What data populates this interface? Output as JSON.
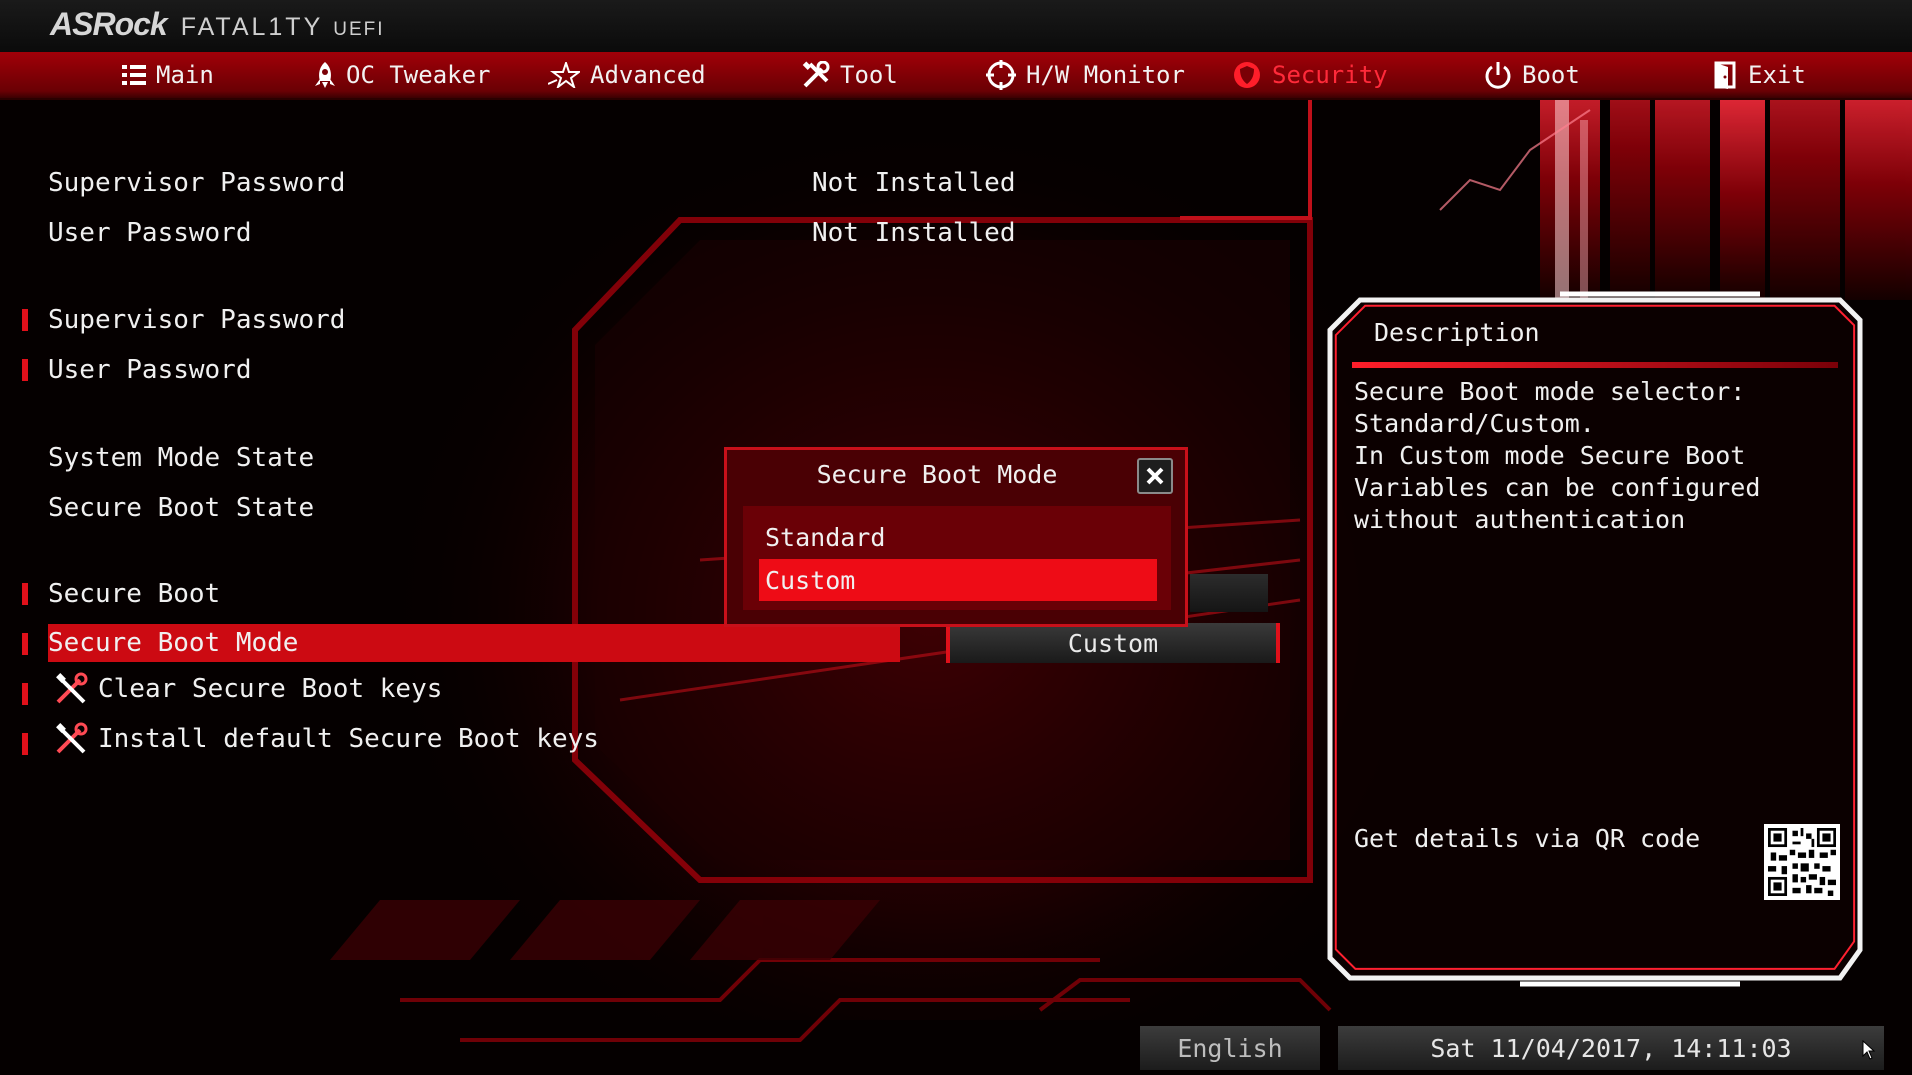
{
  "brand": {
    "name": "ASRock",
    "product": "FATAL1TY",
    "firmware": "UEFI"
  },
  "tabs": [
    {
      "label": "Main",
      "icon": "list-icon",
      "active": false
    },
    {
      "label": "OC Tweaker",
      "icon": "rocket-icon",
      "active": false
    },
    {
      "label": "Advanced",
      "icon": "star-icon",
      "active": false
    },
    {
      "label": "Tool",
      "icon": "wrench-icon",
      "active": false
    },
    {
      "label": "H/W Monitor",
      "icon": "crosshair-icon",
      "active": false
    },
    {
      "label": "Security",
      "icon": "shield-icon",
      "active": true
    },
    {
      "label": "Boot",
      "icon": "power-icon",
      "active": false
    },
    {
      "label": "Exit",
      "icon": "exit-door-icon",
      "active": false
    }
  ],
  "status": {
    "supervisor_password": {
      "label": "Supervisor Password",
      "value": "Not Installed"
    },
    "user_password": {
      "label": "User Password",
      "value": "Not Installed"
    }
  },
  "menu": {
    "set_supervisor_password": "Supervisor Password",
    "set_user_password": "User Password",
    "system_mode_state": "System Mode State",
    "secure_boot_state": "Secure Boot State",
    "secure_boot": "Secure Boot",
    "secure_boot_mode": {
      "label": "Secure Boot Mode",
      "value": "Custom"
    },
    "clear_keys": "Clear Secure Boot keys",
    "install_default_keys": "Install default Secure Boot keys"
  },
  "popup": {
    "title": "Secure Boot Mode",
    "options": [
      "Standard",
      "Custom"
    ],
    "selected": "Custom"
  },
  "description": {
    "title": "Description",
    "text": "Secure Boot mode selector:\nStandard/Custom.\nIn Custom mode Secure Boot\nVariables can be configured\nwithout authentication",
    "qr_label": "Get details via QR code"
  },
  "footer": {
    "language": "English",
    "datetime": "Sat 11/04/2017, 14:11:03"
  },
  "colors": {
    "accent": "#e0101a",
    "active_tab_text": "#ff2a3a",
    "highlight": "#cc0a12",
    "background": "#050000"
  }
}
